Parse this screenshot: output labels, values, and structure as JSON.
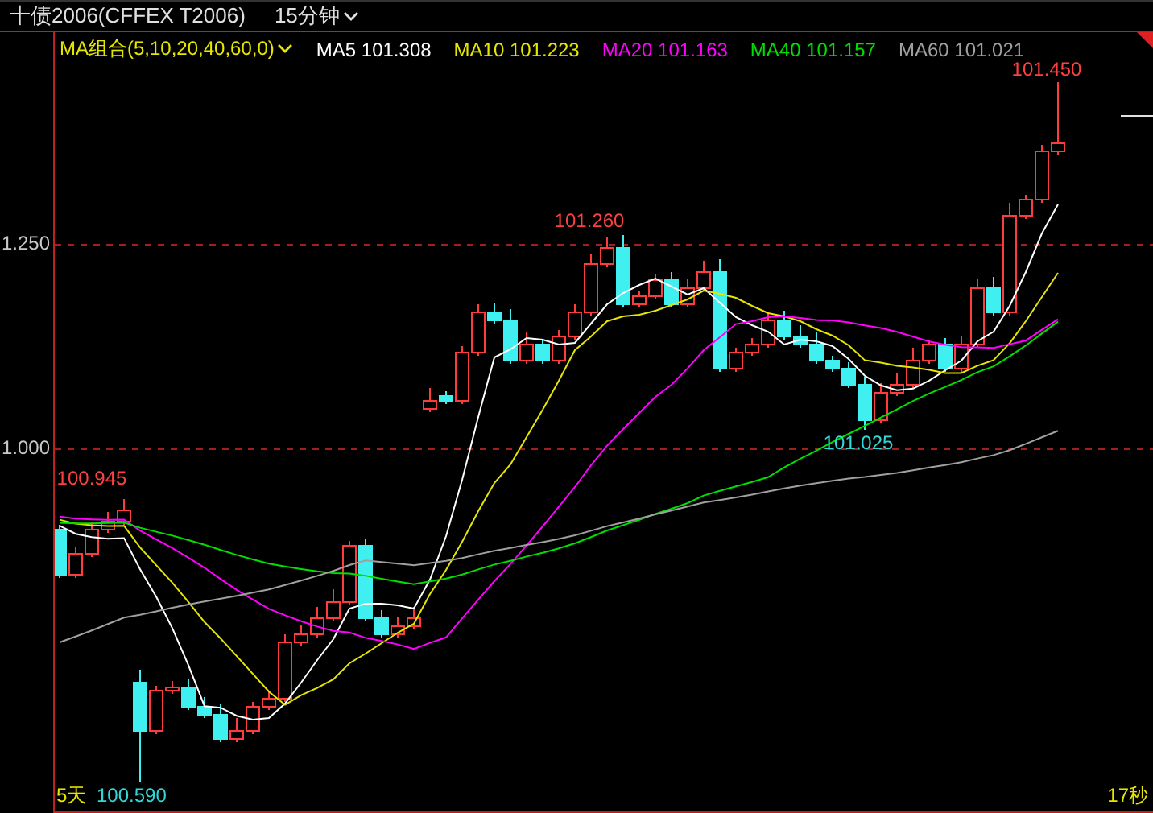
{
  "header": {
    "title": "十债2006(CFFEX T2006)",
    "timeframe": "15分钟"
  },
  "ma_legend": [
    {
      "label": "MA组合(5,10,20,40,60,0)",
      "color": "#e6e600",
      "kind": "selector"
    },
    {
      "label": "MA5 101.308",
      "color": "#ffffff",
      "kind": "line"
    },
    {
      "label": "MA10 101.223",
      "color": "#e6e600",
      "kind": "line"
    },
    {
      "label": "MA20 101.163",
      "color": "#ff00ff",
      "kind": "line"
    },
    {
      "label": "MA40 101.157",
      "color": "#00e000",
      "kind": "line"
    },
    {
      "label": "MA60 101.021",
      "color": "#a0a0a0",
      "kind": "line"
    }
  ],
  "y_axis": [
    "1.250",
    "1.000"
  ],
  "price_labels": [
    {
      "text": "101.450",
      "kind": "high"
    },
    {
      "text": "101.260",
      "kind": "high"
    },
    {
      "text": "101.025",
      "kind": "low"
    },
    {
      "text": "100.945",
      "kind": "high"
    },
    {
      "text": "100.590",
      "kind": "low"
    }
  ],
  "footer": {
    "range": "5天",
    "countdown": "17秒"
  }
}
